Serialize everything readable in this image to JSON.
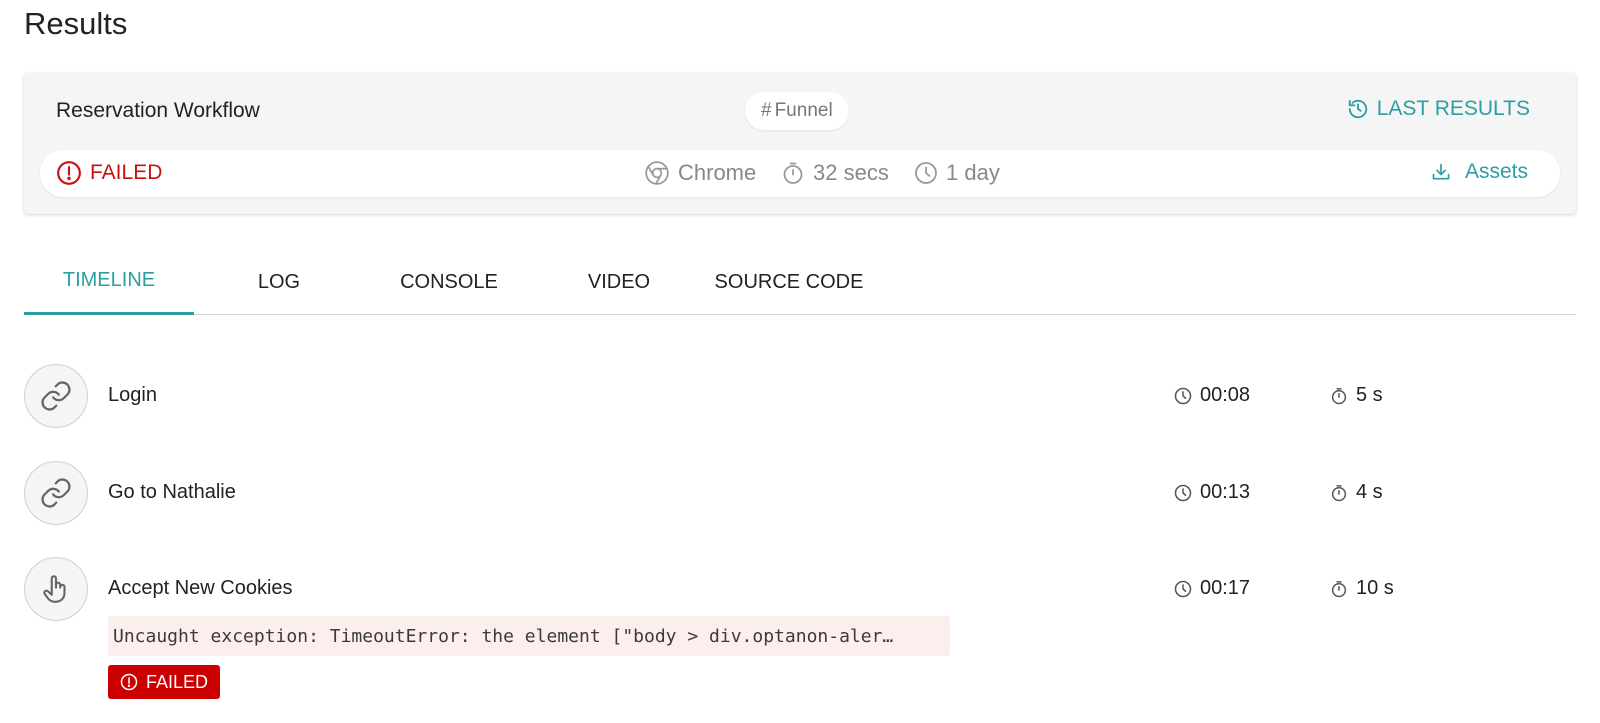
{
  "page": {
    "title": "Results"
  },
  "summary": {
    "test_name": "Reservation Workflow",
    "tag": {
      "hash": "#",
      "label": "Funnel"
    },
    "last_results_label": "LAST RESULTS",
    "status": "FAILED",
    "browser": "Chrome",
    "duration": "32 secs",
    "age": "1 day",
    "assets_label": "Assets"
  },
  "tabs": [
    {
      "label": "TIMELINE",
      "active": true
    },
    {
      "label": "LOG",
      "active": false
    },
    {
      "label": "CONSOLE",
      "active": false
    },
    {
      "label": "VIDEO",
      "active": false
    },
    {
      "label": "SOURCE CODE",
      "active": false
    }
  ],
  "steps": [
    {
      "icon": "link-icon",
      "label": "Login",
      "time": "00:08",
      "duration": "5 s"
    },
    {
      "icon": "link-icon",
      "label": "Go to Nathalie",
      "time": "00:13",
      "duration": "4 s"
    },
    {
      "icon": "pointer-hand-icon",
      "label": "Accept New Cookies",
      "time": "00:17",
      "duration": "10 s",
      "error": "Uncaught exception: TimeoutError: the element [\"body > div.optanon-aler…",
      "status": "FAILED"
    }
  ],
  "colors": {
    "accent": "#2a9fa3",
    "error": "#cc0000",
    "error_bg": "#fdeeee",
    "muted": "#888888"
  }
}
